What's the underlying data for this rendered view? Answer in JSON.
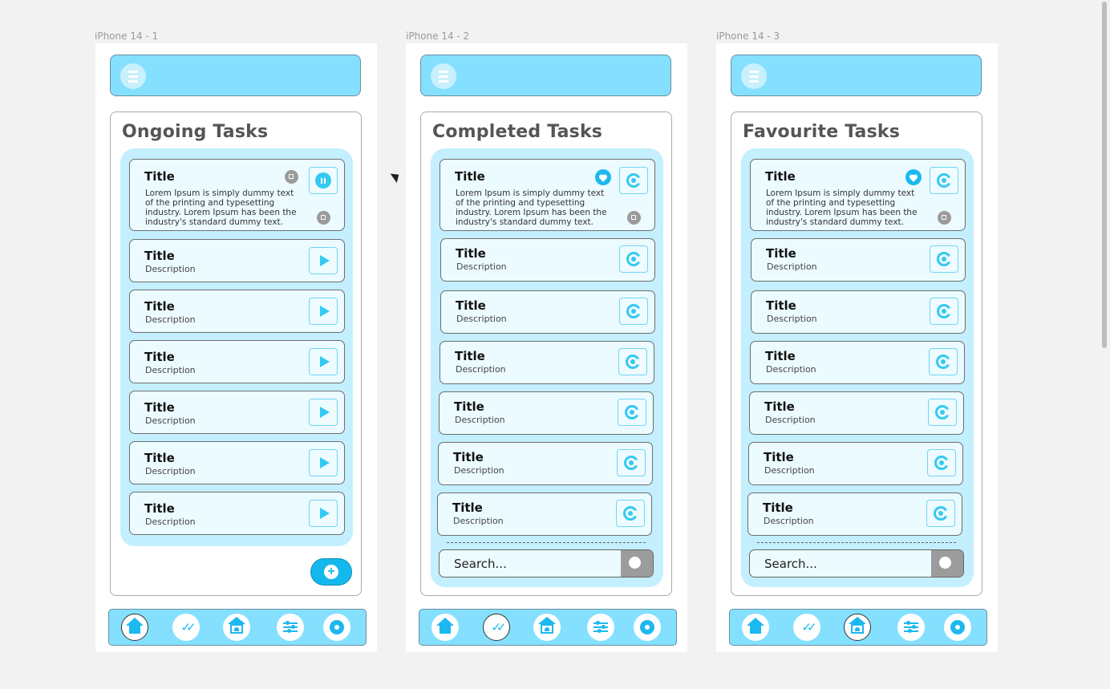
{
  "frames": [
    {
      "label": "iPhone 14 - 1",
      "heading": "Ongoing Tasks",
      "featured": {
        "title": "Title",
        "body": "Lorem Ipsum is simply dummy text of the printing and typesetting industry. Lorem Ipsum has been the industry's standard dummy text.",
        "action": "pause-icon",
        "badge": "tag-icon"
      },
      "items": [
        {
          "title": "Title",
          "desc": "Description"
        },
        {
          "title": "Title",
          "desc": "Description"
        },
        {
          "title": "Title",
          "desc": "Description"
        },
        {
          "title": "Title",
          "desc": "Description"
        },
        {
          "title": "Title",
          "desc": "Description"
        },
        {
          "title": "Title",
          "desc": "Description"
        }
      ],
      "item_action": "play-icon",
      "fab_label": "+",
      "active_nav": "home"
    },
    {
      "label": "iPhone 14 - 2",
      "heading": "Completed Tasks",
      "featured": {
        "title": "Title",
        "body": "Lorem Ipsum is simply dummy text of the printing and typesetting industry. Lorem Ipsum has been the industry's standard dummy text.",
        "action": "redo-icon",
        "badge": "heart-icon"
      },
      "items": [
        {
          "title": "Title",
          "desc": "Description"
        },
        {
          "title": "Title",
          "desc": "Description"
        },
        {
          "title": "Title",
          "desc": "Description"
        },
        {
          "title": "Title",
          "desc": "Description"
        },
        {
          "title": "Title",
          "desc": "Description"
        },
        {
          "title": "Title",
          "desc": "Description"
        }
      ],
      "item_action": "redo-icon",
      "search_placeholder": "Search...",
      "active_nav": "completed"
    },
    {
      "label": "iPhone 14 - 3",
      "heading": "Favourite Tasks",
      "featured": {
        "title": "Title",
        "body": "Lorem Ipsum is simply dummy text of the printing and typesetting industry. Lorem Ipsum has been the industry's standard dummy text.",
        "action": "redo-icon",
        "badge": "heart-icon"
      },
      "items": [
        {
          "title": "Title",
          "desc": "Description"
        },
        {
          "title": "Title",
          "desc": "Description"
        },
        {
          "title": "Title",
          "desc": "Description"
        },
        {
          "title": "Title",
          "desc": "Description"
        },
        {
          "title": "Title",
          "desc": "Description"
        },
        {
          "title": "Title",
          "desc": "Description"
        }
      ],
      "item_action": "redo-icon",
      "search_placeholder": "Search...",
      "active_nav": "favourites"
    }
  ],
  "nav_icons": [
    "home-icon",
    "double-check-icon",
    "heart-home-icon",
    "sliders-icon",
    "gear-icon"
  ],
  "colors": {
    "accent": "#84e0fe",
    "list_bg": "#c3effe",
    "icon": "#1cb8ef",
    "canvas": "#f2f2f2"
  }
}
